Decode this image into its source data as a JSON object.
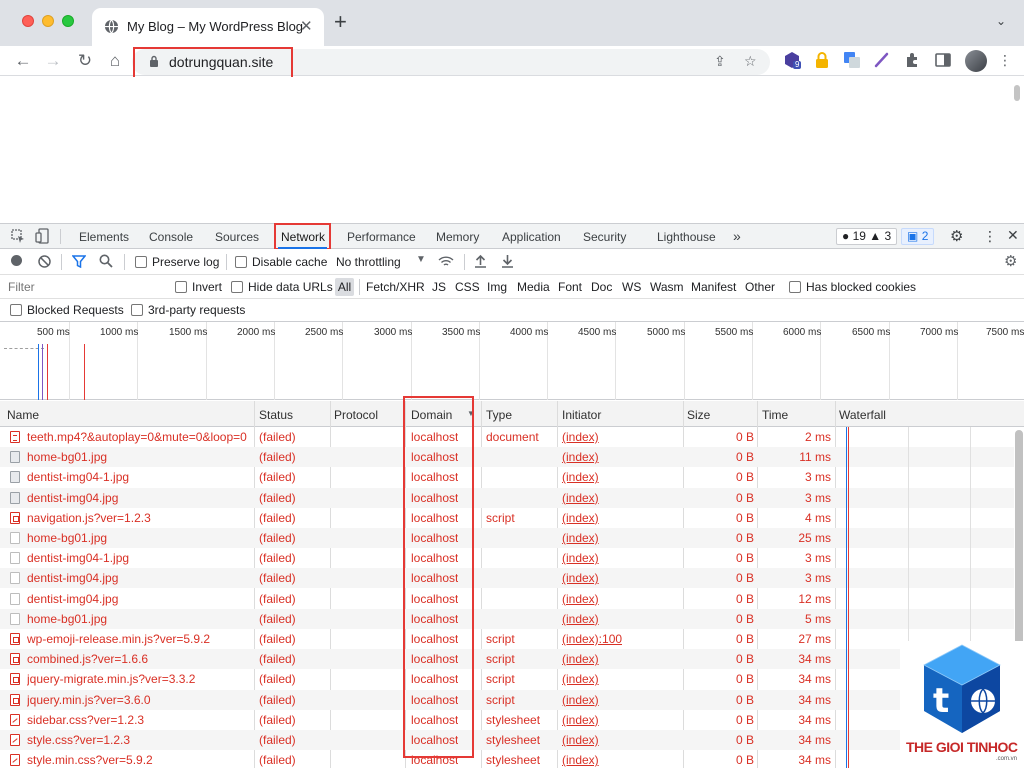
{
  "browser": {
    "tab_title": "My Blog – My WordPress Blog",
    "url": "dotrungquan.site",
    "extension_badge": "9"
  },
  "devtools": {
    "tabs": [
      "Elements",
      "Console",
      "Sources",
      "Network",
      "Performance",
      "Memory",
      "Application",
      "Security",
      "Lighthouse"
    ],
    "more_tabs": "»",
    "errors_count": "19",
    "warnings_count": "3",
    "messages_count": "2",
    "toolbar": {
      "preserve_log": "Preserve log",
      "disable_cache": "Disable cache",
      "throttling": "No throttling"
    },
    "filter": {
      "placeholder": "Filter",
      "invert": "Invert",
      "hide_data_urls": "Hide data URLs",
      "types": [
        "All",
        "Fetch/XHR",
        "JS",
        "CSS",
        "Img",
        "Media",
        "Font",
        "Doc",
        "WS",
        "Wasm",
        "Manifest",
        "Other"
      ],
      "has_blocked_cookies": "Has blocked cookies",
      "blocked_requests": "Blocked Requests",
      "third_party": "3rd-party requests"
    },
    "overview_ticks": [
      "500 ms",
      "1000 ms",
      "1500 ms",
      "2000 ms",
      "2500 ms",
      "3000 ms",
      "3500 ms",
      "4000 ms",
      "4500 ms",
      "5000 ms",
      "5500 ms",
      "6000 ms",
      "6500 ms",
      "7000 ms",
      "7500 ms"
    ]
  },
  "table": {
    "columns": [
      "Name",
      "Status",
      "Protocol",
      "Domain",
      "Type",
      "Initiator",
      "Size",
      "Time",
      "Waterfall"
    ],
    "rows": [
      {
        "icon": "doc",
        "name": "teeth.mp4?&autoplay=0&mute=0&loop=0",
        "status": "(failed)",
        "domain": "localhost",
        "type": "document",
        "initiator": "(index)",
        "size": "0 B",
        "time": "2 ms"
      },
      {
        "icon": "img",
        "name": "home-bg01.jpg",
        "status": "(failed)",
        "domain": "localhost",
        "type": "",
        "initiator": "(index)",
        "size": "0 B",
        "time": "11 ms"
      },
      {
        "icon": "img",
        "name": "dentist-img04-1.jpg",
        "status": "(failed)",
        "domain": "localhost",
        "type": "",
        "initiator": "(index)",
        "size": "0 B",
        "time": "3 ms"
      },
      {
        "icon": "img",
        "name": "dentist-img04.jpg",
        "status": "(failed)",
        "domain": "localhost",
        "type": "",
        "initiator": "(index)",
        "size": "0 B",
        "time": "3 ms"
      },
      {
        "icon": "js",
        "name": "navigation.js?ver=1.2.3",
        "status": "(failed)",
        "domain": "localhost",
        "type": "script",
        "initiator": "(index)",
        "size": "0 B",
        "time": "4 ms"
      },
      {
        "icon": "blank",
        "name": "home-bg01.jpg",
        "status": "(failed)",
        "domain": "localhost",
        "type": "",
        "initiator": "(index)",
        "size": "0 B",
        "time": "25 ms"
      },
      {
        "icon": "blank",
        "name": "dentist-img04-1.jpg",
        "status": "(failed)",
        "domain": "localhost",
        "type": "",
        "initiator": "(index)",
        "size": "0 B",
        "time": "3 ms"
      },
      {
        "icon": "blank",
        "name": "dentist-img04.jpg",
        "status": "(failed)",
        "domain": "localhost",
        "type": "",
        "initiator": "(index)",
        "size": "0 B",
        "time": "3 ms"
      },
      {
        "icon": "blank",
        "name": "dentist-img04.jpg",
        "status": "(failed)",
        "domain": "localhost",
        "type": "",
        "initiator": "(index)",
        "size": "0 B",
        "time": "12 ms"
      },
      {
        "icon": "blank",
        "name": "home-bg01.jpg",
        "status": "(failed)",
        "domain": "localhost",
        "type": "",
        "initiator": "(index)",
        "size": "0 B",
        "time": "5 ms"
      },
      {
        "icon": "js",
        "name": "wp-emoji-release.min.js?ver=5.9.2",
        "status": "(failed)",
        "domain": "localhost",
        "type": "script",
        "initiator": "(index):100",
        "size": "0 B",
        "time": "27 ms"
      },
      {
        "icon": "js",
        "name": "combined.js?ver=1.6.6",
        "status": "(failed)",
        "domain": "localhost",
        "type": "script",
        "initiator": "(index)",
        "size": "0 B",
        "time": "34 ms"
      },
      {
        "icon": "js",
        "name": "jquery-migrate.min.js?ver=3.3.2",
        "status": "(failed)",
        "domain": "localhost",
        "type": "script",
        "initiator": "(index)",
        "size": "0 B",
        "time": "34 ms"
      },
      {
        "icon": "js",
        "name": "jquery.min.js?ver=3.6.0",
        "status": "(failed)",
        "domain": "localhost",
        "type": "script",
        "initiator": "(index)",
        "size": "0 B",
        "time": "34 ms"
      },
      {
        "icon": "css",
        "name": "sidebar.css?ver=1.2.3",
        "status": "(failed)",
        "domain": "localhost",
        "type": "stylesheet",
        "initiator": "(index)",
        "size": "0 B",
        "time": "34 ms"
      },
      {
        "icon": "css",
        "name": "style.css?ver=1.2.3",
        "status": "(failed)",
        "domain": "localhost",
        "type": "stylesheet",
        "initiator": "(index)",
        "size": "0 B",
        "time": "34 ms"
      },
      {
        "icon": "css",
        "name": "style.min.css?ver=5.9.2",
        "status": "(failed)",
        "domain": "localhost",
        "type": "stylesheet",
        "initiator": "(index)",
        "size": "0 B",
        "time": "34 ms"
      }
    ]
  },
  "watermark": {
    "text": "THE GIOI TINHOC",
    "sub": ".com.vn",
    "glyph": "t"
  },
  "colors": {
    "error_red": "#d93025",
    "highlight_red": "#e53935",
    "accent_blue": "#1a73e8"
  }
}
